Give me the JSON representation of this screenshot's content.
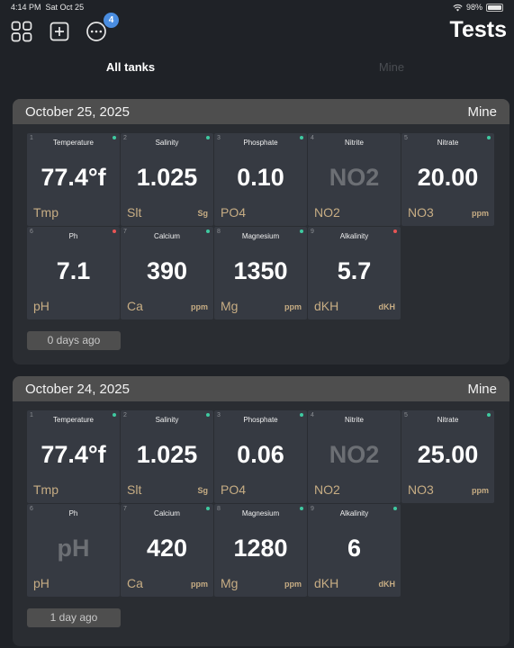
{
  "status_bar": {
    "time": "4:14 PM",
    "date": "Sat Oct 25",
    "battery": "98%",
    "battery_level": 0.98
  },
  "toolbar": {
    "title": "Tests",
    "grid_icon": "grid-icon",
    "add_icon": "plus-square-icon",
    "more_icon": "more-circle-icon",
    "more_badge": "4"
  },
  "tabs": {
    "all": "All tanks",
    "mine": "Mine"
  },
  "colors": {
    "accent_green": "#3fc9a0",
    "alert_red": "#e85555",
    "abbr_tan": "#c7ad84",
    "badge_blue": "#4a8de0"
  },
  "entries": [
    {
      "date": "October 25, 2025",
      "tank": "Mine",
      "ago": "0 days ago",
      "tests": [
        {
          "idx": "1",
          "name": "Temperature",
          "value": "77.4°f",
          "abbr": "Tmp",
          "unit": "",
          "status": "green"
        },
        {
          "idx": "2",
          "name": "Salinity",
          "value": "1.025",
          "abbr": "Slt",
          "unit": "Sg",
          "status": "green"
        },
        {
          "idx": "3",
          "name": "Phosphate",
          "value": "0.10",
          "abbr": "PO4",
          "unit": "",
          "status": "green"
        },
        {
          "idx": "4",
          "name": "Nitrite",
          "value": "NO2",
          "abbr": "NO2",
          "unit": "",
          "status": "none",
          "empty": true
        },
        {
          "idx": "5",
          "name": "Nitrate",
          "value": "20.00",
          "abbr": "NO3",
          "unit": "ppm",
          "status": "green"
        },
        {
          "idx": "6",
          "name": "Ph",
          "value": "7.1",
          "abbr": "pH",
          "unit": "",
          "status": "red"
        },
        {
          "idx": "7",
          "name": "Calcium",
          "value": "390",
          "abbr": "Ca",
          "unit": "ppm",
          "status": "green"
        },
        {
          "idx": "8",
          "name": "Magnesium",
          "value": "1350",
          "abbr": "Mg",
          "unit": "ppm",
          "status": "green"
        },
        {
          "idx": "9",
          "name": "Alkalinity",
          "value": "5.7",
          "abbr": "dKH",
          "unit": "dKH",
          "status": "red"
        }
      ]
    },
    {
      "date": "October 24, 2025",
      "tank": "Mine",
      "ago": "1 day ago",
      "tests": [
        {
          "idx": "1",
          "name": "Temperature",
          "value": "77.4°f",
          "abbr": "Tmp",
          "unit": "",
          "status": "green"
        },
        {
          "idx": "2",
          "name": "Salinity",
          "value": "1.025",
          "abbr": "Slt",
          "unit": "Sg",
          "status": "green"
        },
        {
          "idx": "3",
          "name": "Phosphate",
          "value": "0.06",
          "abbr": "PO4",
          "unit": "",
          "status": "green"
        },
        {
          "idx": "4",
          "name": "Nitrite",
          "value": "NO2",
          "abbr": "NO2",
          "unit": "",
          "status": "none",
          "empty": true
        },
        {
          "idx": "5",
          "name": "Nitrate",
          "value": "25.00",
          "abbr": "NO3",
          "unit": "ppm",
          "status": "green"
        },
        {
          "idx": "6",
          "name": "Ph",
          "value": "pH",
          "abbr": "pH",
          "unit": "",
          "status": "none",
          "empty": true
        },
        {
          "idx": "7",
          "name": "Calcium",
          "value": "420",
          "abbr": "Ca",
          "unit": "ppm",
          "status": "green"
        },
        {
          "idx": "8",
          "name": "Magnesium",
          "value": "1280",
          "abbr": "Mg",
          "unit": "ppm",
          "status": "green"
        },
        {
          "idx": "9",
          "name": "Alkalinity",
          "value": "6",
          "abbr": "dKH",
          "unit": "dKH",
          "status": "green"
        }
      ]
    }
  ]
}
